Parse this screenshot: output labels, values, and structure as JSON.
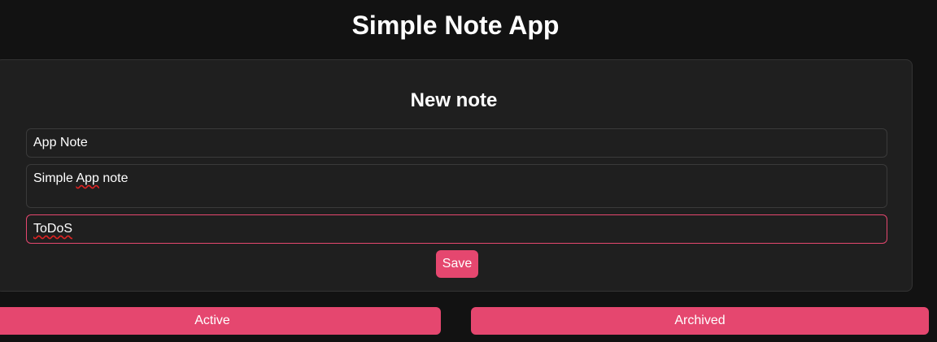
{
  "app": {
    "title": "Simple Note App"
  },
  "form": {
    "heading": "New note",
    "title_value": "App Note",
    "body_value_parts": [
      "Simple ",
      "App",
      " note"
    ],
    "tags_value": "ToDoS",
    "save_label": "Save"
  },
  "tabs": [
    {
      "label": "Active"
    },
    {
      "label": "Archived"
    }
  ],
  "colors": {
    "accent": "#e5476f",
    "background": "#121212",
    "card": "#1f1f1f"
  }
}
